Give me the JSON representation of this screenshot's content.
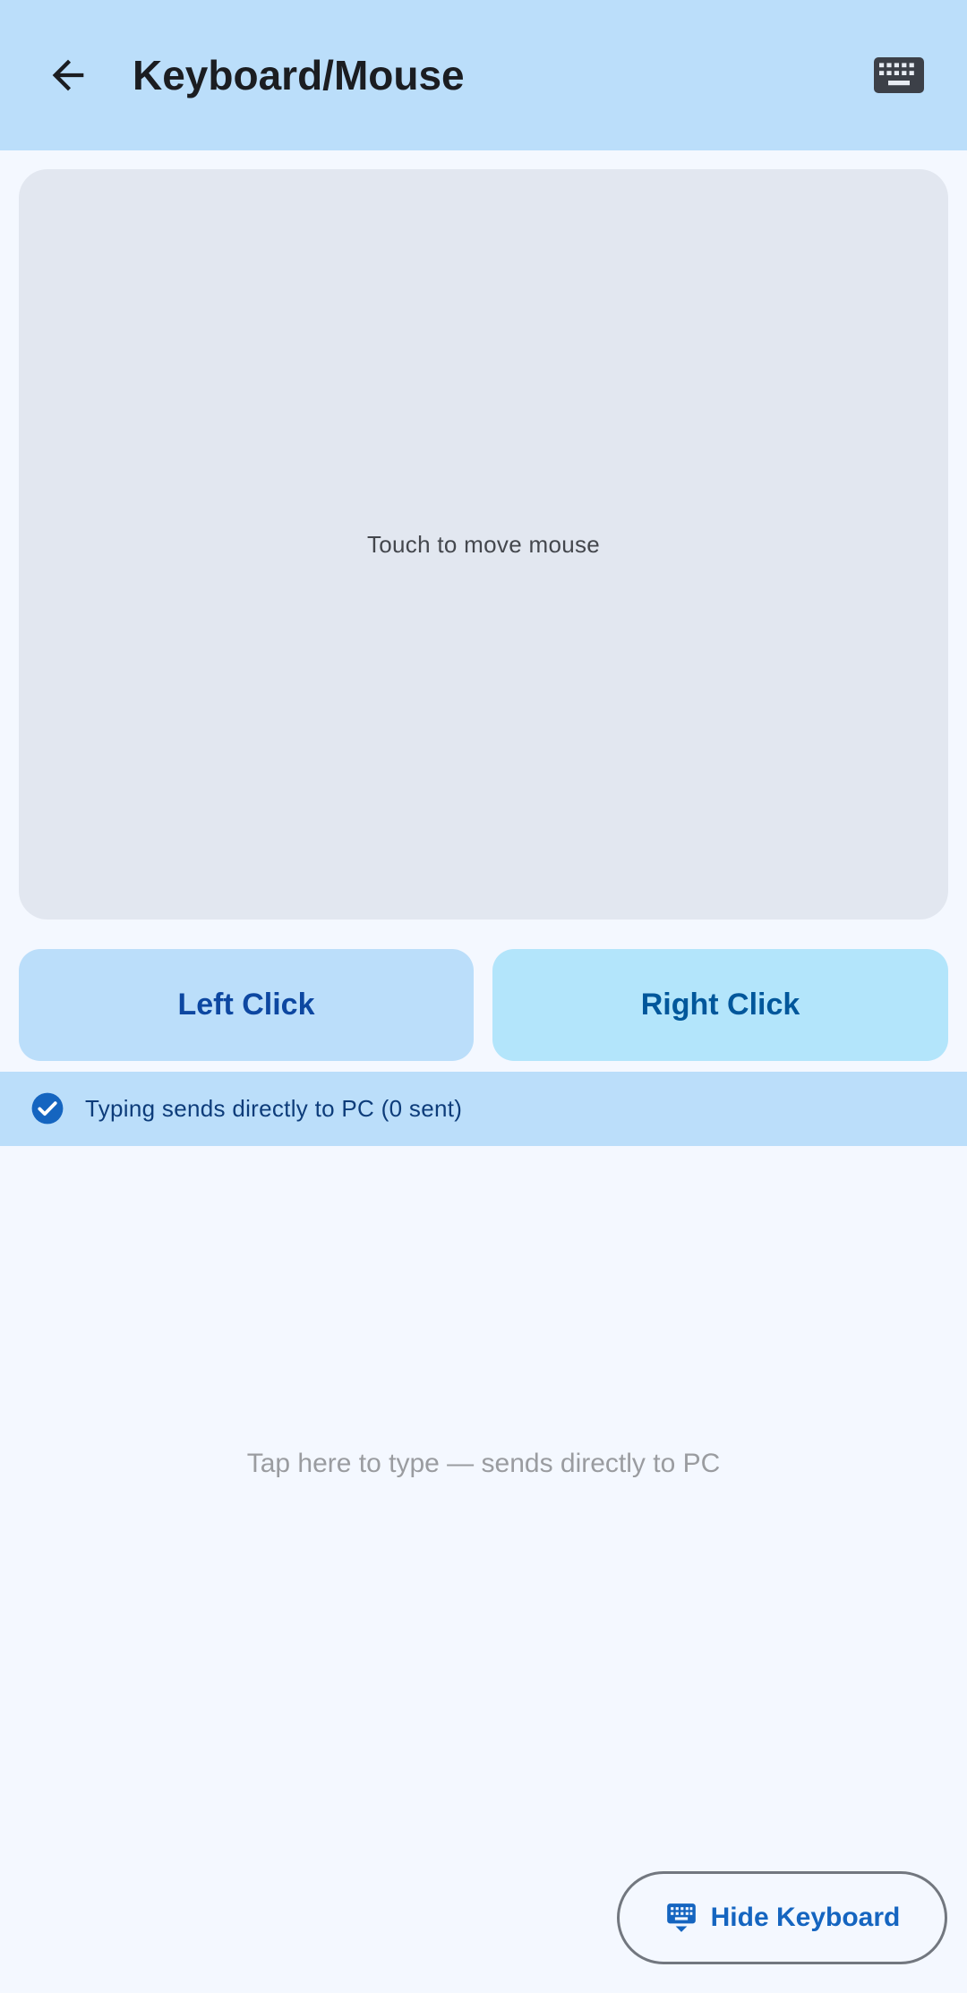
{
  "header": {
    "title": "Keyboard/Mouse",
    "back_icon": "arrow-back-icon",
    "keyboard_icon": "keyboard-icon"
  },
  "touchpad": {
    "hint": "Touch to move mouse"
  },
  "buttons": {
    "left_click": "Left Click",
    "right_click": "Right Click"
  },
  "status": {
    "icon": "check-circle-icon",
    "text": "Typing sends directly to PC (0 sent)"
  },
  "typing_area": {
    "placeholder": "Tap here to type — sends directly to PC"
  },
  "hide_keyboard": {
    "icon": "keyboard-hide-icon",
    "label": "Hide Keyboard"
  },
  "colors": {
    "app_bar": "#bbdefa",
    "background": "#f4f8ff",
    "touchpad": "#e2e7f0",
    "accent": "#1565c0"
  }
}
